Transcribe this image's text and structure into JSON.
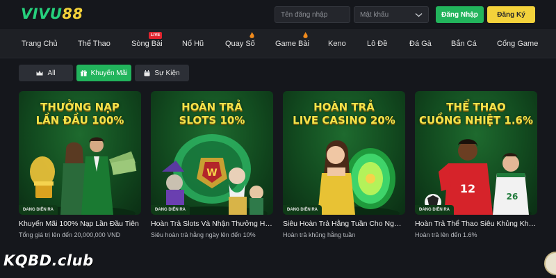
{
  "header": {
    "logo_part1": "VIVU",
    "logo_part2": "88",
    "username_placeholder": "Tên đăng nhập",
    "password_placeholder": "Mật khẩu",
    "login_label": "Đăng Nhập",
    "register_label": "Đăng Ký"
  },
  "nav": {
    "items": [
      {
        "label": "Trang Chủ"
      },
      {
        "label": "Thể Thao"
      },
      {
        "label": "Sòng Bài",
        "badge": "LIVE"
      },
      {
        "label": "Nổ Hũ"
      },
      {
        "label": "Quay Số",
        "icon": "flame-icon"
      },
      {
        "label": "Game Bài",
        "icon": "flame-icon"
      },
      {
        "label": "Keno"
      },
      {
        "label": "Lô Đề"
      },
      {
        "label": "Đá Gà"
      },
      {
        "label": "Bắn Cá"
      },
      {
        "label": "Cổng Game"
      }
    ]
  },
  "categories": [
    {
      "label": "All",
      "icon": "crown-icon",
      "active": false
    },
    {
      "label": "Khuyến Mãi",
      "icon": "gift-icon",
      "active": true
    },
    {
      "label": "Sự Kiện",
      "icon": "calendar-icon",
      "active": false
    }
  ],
  "promos": [
    {
      "banner_line1": "THƯỞNG NẠP",
      "banner_line2": "LẦN ĐẦU 100%",
      "status": "ĐANG DIỄN RA",
      "title": "Khuyến Mãi 100% Nạp Lần Đầu Tiên",
      "subtitle": "Tổng giá trị lên đến 20,000,000 VND"
    },
    {
      "banner_line1": "HOÀN TRẢ",
      "banner_line2": "SLOTS 10%",
      "status": "ĐANG DIỄN RA",
      "title": "Hoàn Trả Slots Và Nhận Thưởng Hấp Dẫn",
      "subtitle": "Siêu hoàn trả hằng ngày lên đến 10%"
    },
    {
      "banner_line1": "HOÀN TRẢ",
      "banner_line2": "LIVE CASINO 20%",
      "status": "ĐANG DIỄN RA",
      "title": "Siêu Hoàn Trả Hằng Tuần Cho Người Chơi",
      "subtitle": "Hoàn trả khủng hằng tuần"
    },
    {
      "banner_line1": "THỂ THAO",
      "banner_line2": "CUỒNG NHIỆT 1.6%",
      "status": "ĐANG DIỄN RA",
      "title": "Hoàn Trả Thể Thao Siêu Khủng Không Giới Hạn",
      "subtitle": "Hoàn trả lên đến 1.6%"
    }
  ],
  "watermark": "KQBD.club",
  "colors": {
    "accent_green": "#22b45c",
    "accent_yellow": "#f3d23b",
    "banner_text": "#f6e24a",
    "live_badge": "#e0242e"
  }
}
